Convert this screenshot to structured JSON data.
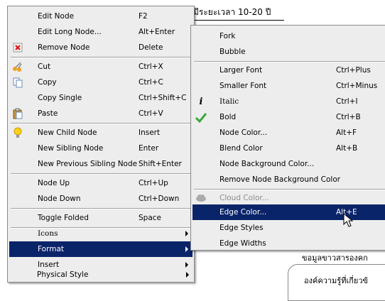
{
  "background": {
    "top_text": "มีระยะเวลา 10-20 ปี",
    "bottom_text_1": "ขอมูลขาวสารองคก",
    "bottom_text_2": "องค์ความรู้ที่เกี่ยวข้"
  },
  "main_menu": {
    "items": [
      {
        "label": "Edit Node",
        "shortcut": "F2",
        "icon": ""
      },
      {
        "label": "Edit Long Node...",
        "shortcut": "Alt+Enter",
        "icon": ""
      },
      {
        "label": "Remove Node",
        "shortcut": "Delete",
        "icon": "remove-icon"
      },
      {
        "label": "Cut",
        "shortcut": "Ctrl+X",
        "icon": "scissors-icon"
      },
      {
        "label": "Copy",
        "shortcut": "Ctrl+C",
        "icon": "copy-icon"
      },
      {
        "label": "Copy Single",
        "shortcut": "Ctrl+Shift+C",
        "icon": ""
      },
      {
        "label": "Paste",
        "shortcut": "Ctrl+V",
        "icon": "clipboard-icon"
      },
      {
        "label": "New Child Node",
        "shortcut": "Insert",
        "icon": "lightbulb-icon"
      },
      {
        "label": "New Sibling Node",
        "shortcut": "Enter",
        "icon": ""
      },
      {
        "label": "New Previous Sibling Node",
        "shortcut": "Shift+Enter",
        "icon": ""
      },
      {
        "label": "Node Up",
        "shortcut": "Ctrl+Up",
        "icon": ""
      },
      {
        "label": "Node Down",
        "shortcut": "Ctrl+Down",
        "icon": ""
      },
      {
        "label": "Toggle Folded",
        "shortcut": "Space",
        "icon": ""
      },
      {
        "label": "Icons",
        "shortcut": "",
        "icon": ""
      },
      {
        "label": "Format",
        "shortcut": "",
        "icon": ""
      },
      {
        "label": "Insert",
        "shortcut": "",
        "icon": ""
      },
      {
        "label": "Physical Style",
        "shortcut": "",
        "icon": ""
      }
    ]
  },
  "format_menu": {
    "items": [
      {
        "label": "Fork",
        "shortcut": ""
      },
      {
        "label": "Bubble",
        "shortcut": ""
      },
      {
        "label": "Larger Font",
        "shortcut": "Ctrl+Plus"
      },
      {
        "label": "Smaller Font",
        "shortcut": "Ctrl+Minus"
      },
      {
        "label": "Italic",
        "shortcut": "Ctrl+I",
        "icon": "italic-icon"
      },
      {
        "label": "Bold",
        "shortcut": "Ctrl+B",
        "icon": "checkmark-icon"
      },
      {
        "label": "Node Color...",
        "shortcut": "Alt+F"
      },
      {
        "label": "Blend Color",
        "shortcut": "Alt+B"
      },
      {
        "label": "Node Background Color...",
        "shortcut": ""
      },
      {
        "label": "Remove Node Background Color",
        "shortcut": ""
      },
      {
        "label": "Cloud Color...",
        "shortcut": "",
        "icon": "cloud-icon"
      },
      {
        "label": "Edge Color...",
        "shortcut": "Alt+E"
      },
      {
        "label": "Edge Styles",
        "shortcut": ""
      },
      {
        "label": "Edge Widths",
        "shortcut": ""
      }
    ]
  },
  "colors": {
    "selection": "#0a246a",
    "menu_bg": "#ededed"
  }
}
